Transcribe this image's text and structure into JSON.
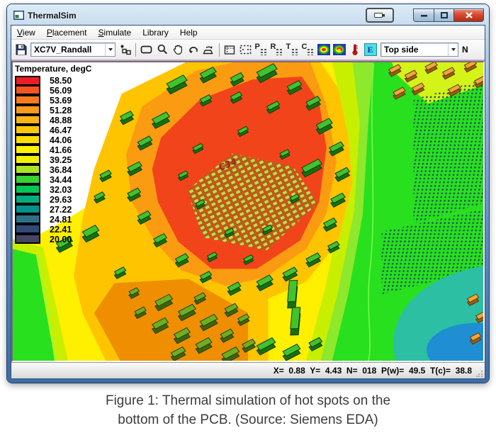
{
  "window": {
    "title": "ThermalSim",
    "controls": {
      "overlay": "capture",
      "minimize": "minimize",
      "maximize": "maximize",
      "close": "close"
    }
  },
  "menu": {
    "items": [
      {
        "label": "View",
        "underline": true
      },
      {
        "label": "Placement",
        "underline": true
      },
      {
        "label": "Simulate",
        "underline": true
      },
      {
        "label": "Library",
        "underline": false
      },
      {
        "label": "Help",
        "underline": false
      }
    ]
  },
  "toolbar": {
    "component_combo": {
      "value": "XC7V_Randall"
    },
    "side_combo": {
      "value": "Top side"
    },
    "partial_label": "N",
    "grid_icons": [
      "P",
      "R",
      "T",
      "C"
    ],
    "emissivity_label": "E",
    "icons": [
      "save-icon",
      "place-component-icon",
      "rect-select-icon",
      "zoom-icon",
      "pan-icon",
      "rotate-ccw-icon",
      "rotate-object-icon",
      "region-select-icon",
      "marquee-select-icon",
      "grid-p-icon",
      "grid-r-icon",
      "grid-t-icon",
      "grid-c-icon",
      "thermal-map-icon",
      "gradient-map-icon",
      "thermometer-icon",
      "emissivity-icon"
    ]
  },
  "legend": {
    "title": "Temperature, degC",
    "entries": [
      {
        "value": "58.50",
        "color": "#ec1c24"
      },
      {
        "value": "56.09",
        "color": "#f4541f"
      },
      {
        "value": "53.69",
        "color": "#f67a1e"
      },
      {
        "value": "51.28",
        "color": "#f89b1b"
      },
      {
        "value": "48.88",
        "color": "#fab415"
      },
      {
        "value": "46.47",
        "color": "#fcc70b"
      },
      {
        "value": "44.06",
        "color": "#fedd00"
      },
      {
        "value": "41.66",
        "color": "#fff200"
      },
      {
        "value": "39.25",
        "color": "#f2f200"
      },
      {
        "value": "36.84",
        "color": "#abe421"
      },
      {
        "value": "34.44",
        "color": "#35d42e"
      },
      {
        "value": "32.03",
        "color": "#00c853"
      },
      {
        "value": "29.63",
        "color": "#00ad7c"
      },
      {
        "value": "27.22",
        "color": "#00928d"
      },
      {
        "value": "24.81",
        "color": "#2a7186"
      },
      {
        "value": "22.41",
        "color": "#2f4a78"
      },
      {
        "value": "20.00",
        "color": "#454563"
      }
    ]
  },
  "map": {
    "hotspot_label": "C34"
  },
  "statusbar": {
    "fields": [
      {
        "label": "X=",
        "value": "0.88"
      },
      {
        "label": "Y=",
        "value": "4.43"
      },
      {
        "label": "N=",
        "value": "018"
      },
      {
        "label": "P(w)=",
        "value": "49.5"
      },
      {
        "label": "T(c)=",
        "value": "38.8"
      }
    ]
  },
  "caption": {
    "line1": "Figure 1: Thermal simulation of hot spots on the",
    "line2": "bottom of the PCB. (Source: Siemens EDA)"
  }
}
